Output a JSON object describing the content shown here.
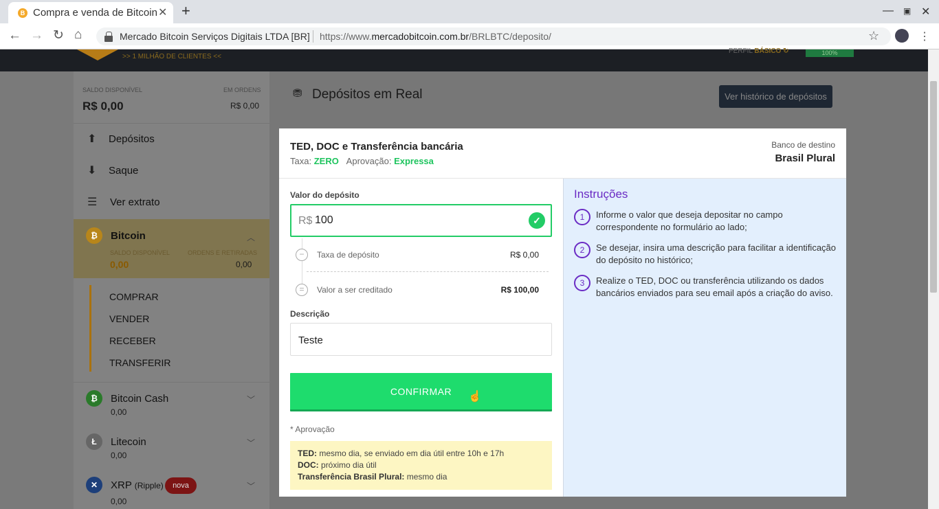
{
  "browser": {
    "tab_title": "Compra e venda de Bitcoin",
    "tab_favicon_letter": "B",
    "org": "Mercado Bitcoin Serviços Digitais LTDA [BR]",
    "url_prefix": "https://www.",
    "url_domain": "mercadobitcoin.com.br",
    "url_path": "/BRLBTC/deposito/"
  },
  "header": {
    "clients": ">> 1 MILHÃO DE CLIENTES <<",
    "perfil_label": "PERFIL",
    "perfil_value": "BÁSICO",
    "perfil_percent": "100%"
  },
  "sidebar": {
    "saldo_label": "SALDO DISPONÍVEL",
    "saldo_value": "R$ 0,00",
    "ordens_label": "EM ORDENS",
    "ordens_value": "R$ 0,00",
    "menu": [
      {
        "label": "Depósitos",
        "icon": "upload-icon"
      },
      {
        "label": "Saque",
        "icon": "download-icon"
      },
      {
        "label": "Ver extrato",
        "icon": "list-icon"
      }
    ],
    "bitcoin": {
      "name": "Bitcoin",
      "saldo_label": "SALDO DISPONÍVEL",
      "saldo_value": "0,00",
      "ordens_label": "ORDENS E RETIRADAS",
      "ordens_value": "0,00",
      "submenu": [
        "COMPRAR",
        "VENDER",
        "RECEBER",
        "TRANSFERIR"
      ]
    },
    "coins": [
      {
        "name": "Bitcoin Cash",
        "value": "0,00",
        "color": "#2a7a2a"
      },
      {
        "name": "Litecoin",
        "value": "0,00",
        "color": "#666666"
      },
      {
        "name": "XRP",
        "suffix": "(Ripple)",
        "value": "0,00",
        "badge": "nova",
        "color": "#1d3f7a"
      }
    ]
  },
  "main": {
    "title": "Depósitos em Real",
    "history_button": "Ver histórico de depósitos",
    "method_title": "TED, DOC e Transferência bancária",
    "taxa_label": "Taxa:",
    "taxa_value": "ZERO",
    "aprov_label": "Aprovação:",
    "aprov_value": "Expressa",
    "banco_label": "Banco de destino",
    "banco_name": "Brasil Plural",
    "valor_label": "Valor do depósito",
    "currency": "R$",
    "valor_input": "100",
    "fee_label": "Taxa de depósito",
    "fee_value": "R$ 0,00",
    "credit_label": "Valor a ser creditado",
    "credit_value": "R$ 100,00",
    "desc_label": "Descrição",
    "desc_input": "Teste",
    "confirm_button": "CONFIRMAR",
    "aprovacao_note": "* Aprovação",
    "notes": [
      {
        "label": "TED:",
        "text": "mesmo dia, se enviado em dia útil entre 10h e 17h"
      },
      {
        "label": "DOC:",
        "text": "próximo dia útil"
      },
      {
        "label": "Transferência Brasil Plural:",
        "text": "mesmo dia"
      }
    ]
  },
  "instructions": {
    "title": "Instruções",
    "steps": [
      {
        "num": "1",
        "text": "Informe o valor que deseja depositar no campo correspondente no formulário ao lado;"
      },
      {
        "num": "2",
        "text": "Se desejar, insira uma descrição para facilitar a identificação do depósito no histórico;"
      },
      {
        "num": "3",
        "text": "Realize o TED, DOC ou transferência utilizando os dados bancários enviados para seu email após a criação do aviso."
      }
    ]
  },
  "colors": {
    "accent_green": "#1edc6d",
    "accent_purple": "#6a2bc4",
    "overlay_bg": "#7a7a7a"
  }
}
